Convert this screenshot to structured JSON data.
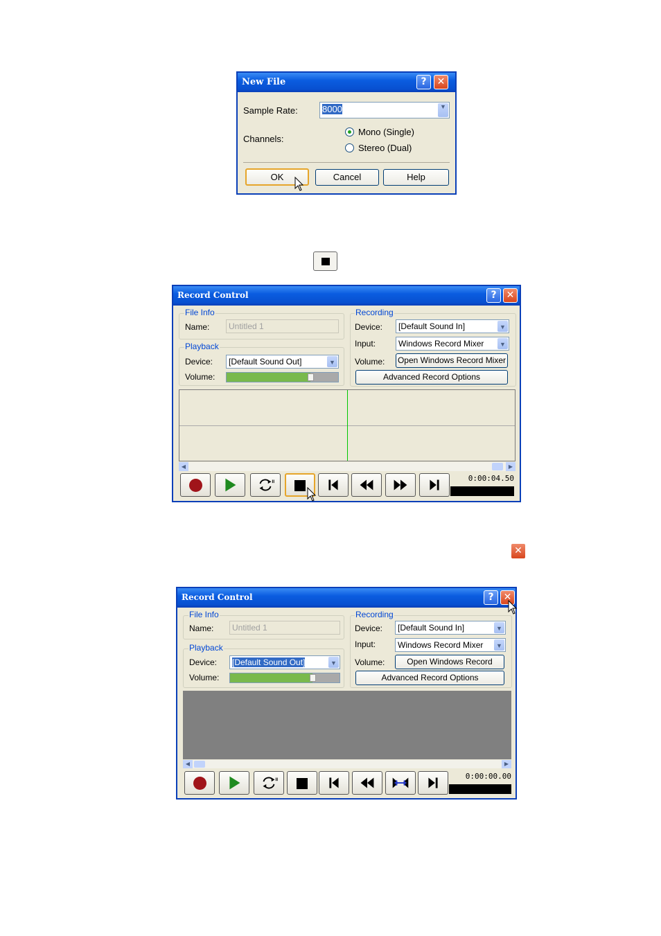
{
  "newfile": {
    "title": "New File",
    "sample_rate_label": "Sample Rate:",
    "sample_rate_value": "8000",
    "channels_label": "Channels:",
    "mono_label": "Mono (Single)",
    "stereo_label": "Stereo (Dual)",
    "ok": "OK",
    "cancel": "Cancel",
    "help": "Help"
  },
  "rc1": {
    "title": "Record Control",
    "file_info": "File Info",
    "name_label": "Name:",
    "name_value": "Untitled 1",
    "playback": "Playback",
    "pb_device_label": "Device:",
    "pb_device_value": "[Default Sound Out]",
    "volume_label": "Volume:",
    "volume_level": 0.75,
    "recording": "Recording",
    "rec_device_label": "Device:",
    "rec_device_value": "[Default Sound In]",
    "input_label": "Input:",
    "input_value": "Windows Record Mixer",
    "rec_volume_label": "Volume:",
    "open_mixer": "Open Windows Record Mixer",
    "advanced": "Advanced Record Options",
    "time": "0:00:04.50"
  },
  "rc2": {
    "title": "Record Control",
    "file_info": "File Info",
    "name_label": "Name:",
    "name_value": "Untitled 1",
    "playback": "Playback",
    "pb_device_label": "Device:",
    "pb_device_value": "[Default Sound Out]",
    "volume_label": "Volume:",
    "volume_level": 0.75,
    "recording": "Recording",
    "rec_device_label": "Device:",
    "rec_device_value": "[Default Sound In]",
    "input_label": "Input:",
    "input_value": "Windows Record Mixer",
    "rec_volume_label": "Volume:",
    "open_mixer": "Open Windows Record Mixer",
    "advanced": "Advanced Record Options",
    "time": "0:00:00.00"
  },
  "colors": {
    "title_blue": "#0a5ce0",
    "record_red": "#a0141a",
    "play_green": "#1f8a1f",
    "close_red": "#d8461e"
  }
}
